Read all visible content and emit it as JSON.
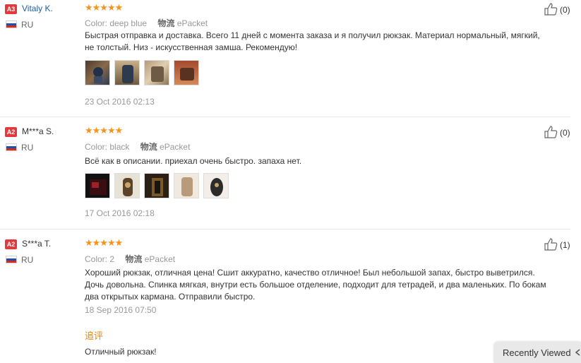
{
  "reviews": [
    {
      "badge": "A3",
      "user": "Vitaly K.",
      "country": "RU",
      "stars": "★★★★★",
      "color_label": "Color:",
      "color_value": "deep blue",
      "shipping_label": "物流",
      "shipping_value": "ePacket",
      "text_lines": [
        "Быстрая отправка и доставка. Всего 11 дней с момента заказа и я получил рюкзак. Материал нормальный, мягкий,",
        "не толстый. Низ - искусственная замша. Рекомендую!"
      ],
      "photo_count": 4,
      "date": "23 Oct 2016 02:13",
      "likes": "(0)"
    },
    {
      "badge": "A2",
      "user": "M***a S.",
      "country": "RU",
      "stars": "★★★★★",
      "color_label": "Color:",
      "color_value": "black",
      "shipping_label": "物流",
      "shipping_value": "ePacket",
      "text_lines": [
        "Всё как в описании. приехал очень быстро. запаха нет."
      ],
      "photo_count": 5,
      "date": "17 Oct 2016 02:18",
      "likes": "(0)"
    },
    {
      "badge": "A2",
      "user": "S***a T.",
      "country": "RU",
      "stars": "★★★★★",
      "color_label": "Color:",
      "color_value": "2",
      "shipping_label": "物流",
      "shipping_value": "ePacket",
      "text_lines": [
        "Хороший рюкзак, отличная цена! Сшит аккуратно, качество отличное! Был небольшой запах, быстро выветрился.",
        "Дочь довольна. Спинка мягкая, внутри есть большое отделение, подходит для тетрадей, и два маленьких. По бокам",
        "два открытых кармана. Отправили быстро."
      ],
      "date": "18 Sep 2016 07:50",
      "likes": "(1)",
      "additional_label": "追评",
      "additional_text": "Отличный рюкзак!"
    }
  ],
  "recently_viewed": "Recently Viewed",
  "colors": {
    "badge": "#e4393c",
    "stars": "#f7931e",
    "link": "#1c5c9a",
    "additional": "#f08300"
  }
}
